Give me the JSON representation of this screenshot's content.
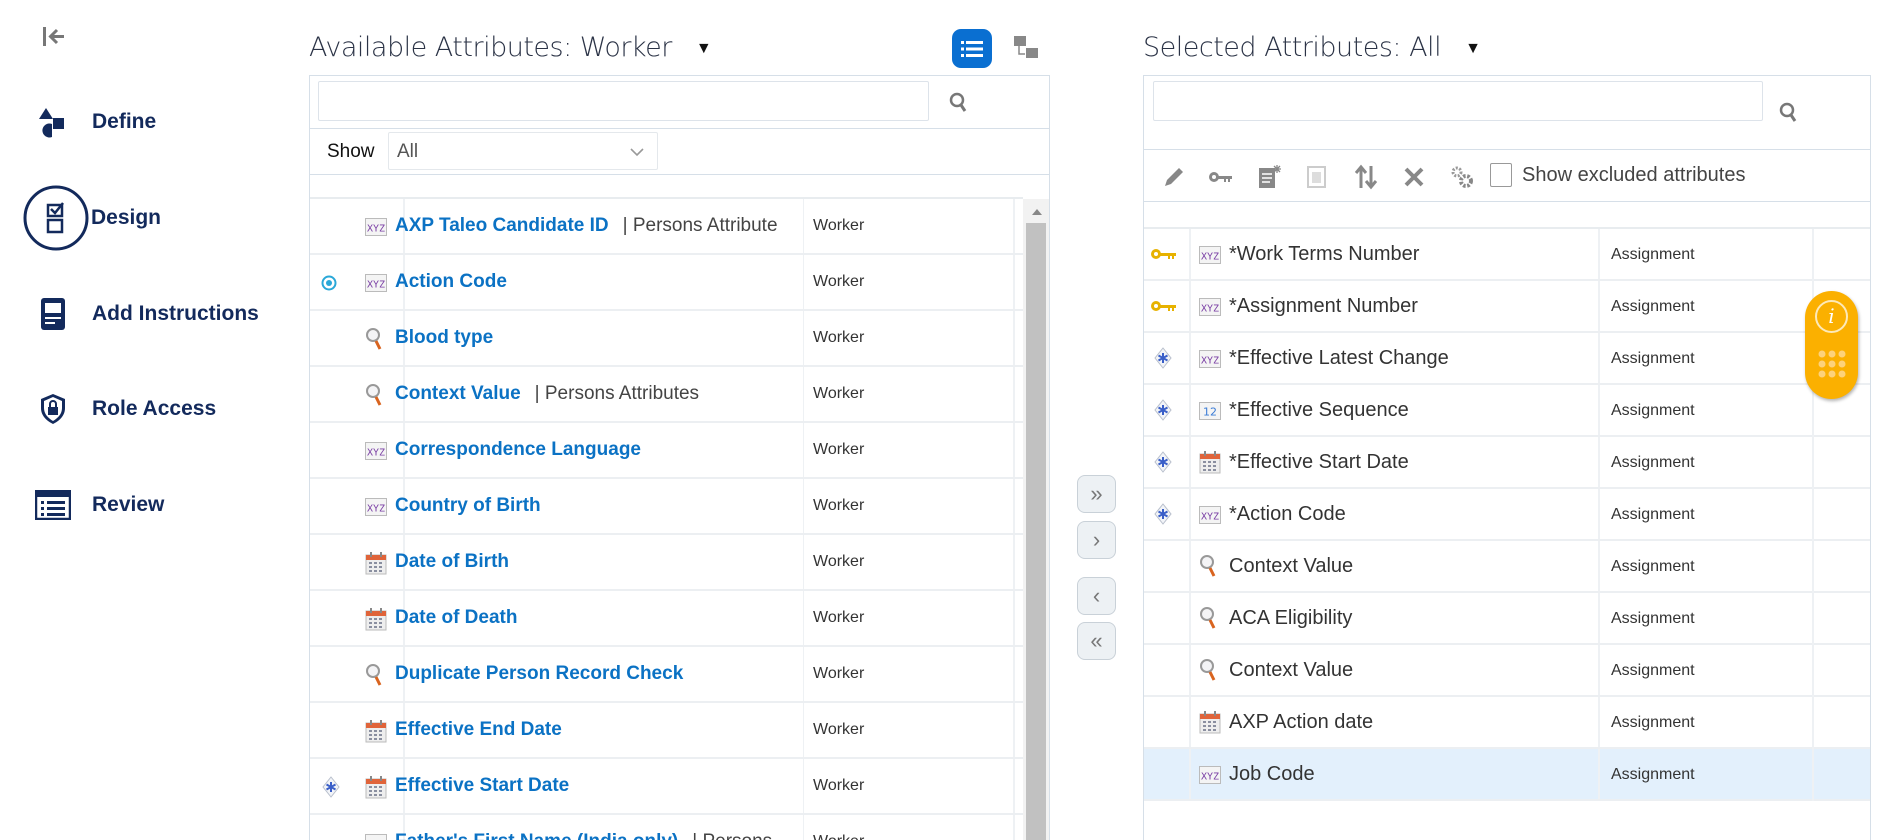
{
  "nav": {
    "items": [
      {
        "label": "Define",
        "icon": "shapes-icon"
      },
      {
        "label": "Design",
        "icon": "checklist-icon",
        "active": true
      },
      {
        "label": "Add Instructions",
        "icon": "instructions-icon"
      },
      {
        "label": "Role Access",
        "icon": "shield-lock-icon"
      },
      {
        "label": "Review",
        "icon": "review-list-icon"
      }
    ]
  },
  "available": {
    "title": "Available Attributes: Worker",
    "search_value": "",
    "show_label": "Show",
    "show_value": "All",
    "rows": [
      {
        "name": "AXP Taleo Candidate ID",
        "suffix": "| Persons Attribute",
        "cat": "Worker",
        "type": "text",
        "mark": ""
      },
      {
        "name": "Action Code",
        "suffix": "",
        "cat": "Worker",
        "type": "text",
        "mark": "radio"
      },
      {
        "name": "Blood type",
        "suffix": "",
        "cat": "Worker",
        "type": "lookup",
        "mark": ""
      },
      {
        "name": "Context Value",
        "suffix": "| Persons Attributes",
        "cat": "Worker",
        "type": "lookup",
        "mark": ""
      },
      {
        "name": "Correspondence Language",
        "suffix": "",
        "cat": "Worker",
        "type": "text",
        "mark": ""
      },
      {
        "name": "Country of Birth",
        "suffix": "",
        "cat": "Worker",
        "type": "text",
        "mark": ""
      },
      {
        "name": "Date of Birth",
        "suffix": "",
        "cat": "Worker",
        "type": "date",
        "mark": ""
      },
      {
        "name": "Date of Death",
        "suffix": "",
        "cat": "Worker",
        "type": "date",
        "mark": ""
      },
      {
        "name": "Duplicate Person Record Check",
        "suffix": "",
        "cat": "Worker",
        "type": "lookup",
        "mark": ""
      },
      {
        "name": "Effective End Date",
        "suffix": "",
        "cat": "Worker",
        "type": "date",
        "mark": ""
      },
      {
        "name": "Effective Start Date",
        "suffix": "",
        "cat": "Worker",
        "type": "date",
        "mark": "required"
      },
      {
        "name": "Father's First Name (India only)",
        "suffix": "| Persons",
        "cat": "Worker",
        "type": "text",
        "mark": ""
      }
    ]
  },
  "move_buttons": [
    "»",
    "›",
    "‹",
    "«"
  ],
  "selected": {
    "title": "Selected Attributes: All",
    "search_value": "",
    "show_excluded_label": "Show excluded attributes",
    "rows": [
      {
        "name": "*Work Terms Number",
        "cat": "Assignment",
        "type": "text",
        "mark": "key"
      },
      {
        "name": "*Assignment Number",
        "cat": "Assignment",
        "type": "text",
        "mark": "key"
      },
      {
        "name": "*Effective Latest Change",
        "cat": "Assignment",
        "type": "text",
        "mark": "required"
      },
      {
        "name": "*Effective Sequence",
        "cat": "Assignment",
        "type": "number",
        "mark": "required"
      },
      {
        "name": "*Effective Start Date",
        "cat": "Assignment",
        "type": "date",
        "mark": "required"
      },
      {
        "name": "*Action Code",
        "cat": "Assignment",
        "type": "text",
        "mark": "required"
      },
      {
        "name": "Context Value",
        "cat": "Assignment",
        "type": "lookup",
        "mark": ""
      },
      {
        "name": "ACA Eligibility",
        "cat": "Assignment",
        "type": "lookup",
        "mark": ""
      },
      {
        "name": "Context Value",
        "cat": "Assignment",
        "type": "lookup",
        "mark": ""
      },
      {
        "name": "AXP Action date",
        "cat": "Assignment",
        "type": "date",
        "mark": ""
      },
      {
        "name": "Job Code",
        "cat": "Assignment",
        "type": "text",
        "mark": "",
        "selected": true
      }
    ]
  },
  "colors": {
    "link": "#0b72c4",
    "nav": "#132a5c",
    "accent": "#0a6fd1",
    "selected_row": "#e3f0fc",
    "info": "#fbb000"
  }
}
